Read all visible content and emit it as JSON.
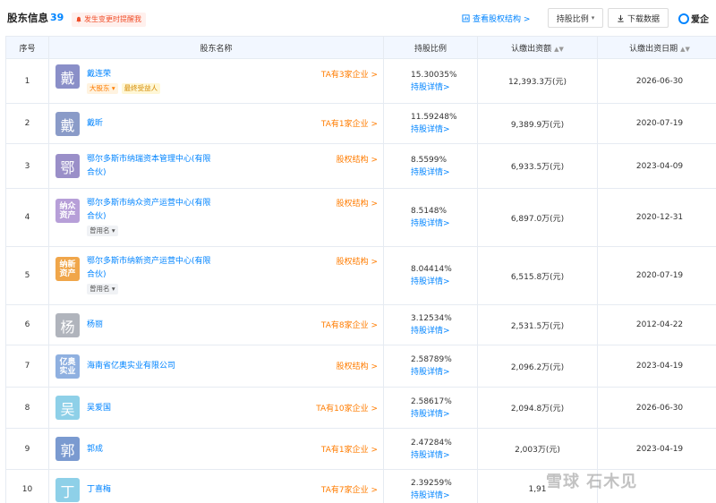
{
  "header": {
    "title": "股东信息",
    "count": "39",
    "remind_label": "发生变更时提醒我",
    "equity_chart_link": "查看股权结构 >",
    "sort_button": "持股比例",
    "download_button": "下载数据",
    "logo_text": "爱企"
  },
  "table": {
    "columns": [
      "序号",
      "股东名称",
      "持股比例",
      "认缴出资额",
      "认缴出资日期"
    ],
    "rows": [
      {
        "idx": "1",
        "avatar": "戴",
        "avatar_color": "#8a8fc8",
        "name_lines": [
          "戴连荣"
        ],
        "tags": [
          "大股东",
          "最终受益人"
        ],
        "right_link": "TA有3家企业 >",
        "ratio": "15.30035%",
        "ratio_link": "持股详情>",
        "capital": "12,393.3万(元)",
        "date": "2026-06-30"
      },
      {
        "idx": "2",
        "avatar": "戴",
        "avatar_color": "#8a9bc8",
        "name_lines": [
          "戴昕"
        ],
        "tags": [],
        "right_link": "TA有1家企业 >",
        "ratio": "11.59248%",
        "ratio_link": "持股详情>",
        "capital": "9,389.9万(元)",
        "date": "2020-07-19"
      },
      {
        "idx": "3",
        "avatar": "鄂",
        "avatar_color": "#9a8fc8",
        "name_lines": [
          "鄂尔多斯市纳瑞资本管理中心(有限",
          "合伙)"
        ],
        "tags": [],
        "right_link": "股权结构 >",
        "ratio": "8.5599%",
        "ratio_link": "持股详情>",
        "capital": "6,933.5万(元)",
        "date": "2023-04-09"
      },
      {
        "idx": "4",
        "avatar": "纳众\n资产",
        "avatar_color": "#b79fd8",
        "name_lines": [
          "鄂尔多斯市纳众资产运营中心(有限",
          "合伙)"
        ],
        "tags": [
          "曾用名"
        ],
        "right_link": "股权结构 >",
        "ratio": "8.5148%",
        "ratio_link": "持股详情>",
        "capital": "6,897.0万(元)",
        "date": "2020-12-31"
      },
      {
        "idx": "5",
        "avatar": "纳新\n资产",
        "avatar_color": "#f0a64a",
        "name_lines": [
          "鄂尔多斯市纳新资产运营中心(有限",
          "合伙)"
        ],
        "tags": [
          "曾用名"
        ],
        "right_link": "股权结构 >",
        "ratio": "8.04414%",
        "ratio_link": "持股详情>",
        "capital": "6,515.8万(元)",
        "date": "2020-07-19"
      },
      {
        "idx": "6",
        "avatar": "杨",
        "avatar_color": "#b0b4bc",
        "name_lines": [
          "杨丽"
        ],
        "tags": [],
        "right_link": "TA有8家企业 >",
        "ratio": "3.12534%",
        "ratio_link": "持股详情>",
        "capital": "2,531.5万(元)",
        "date": "2012-04-22"
      },
      {
        "idx": "7",
        "avatar": "亿奥\n实业",
        "avatar_color": "#8fb0e0",
        "name_lines": [
          "海南省亿奥实业有限公司"
        ],
        "tags": [],
        "right_link": "股权结构 >",
        "ratio": "2.58789%",
        "ratio_link": "持股详情>",
        "capital": "2,096.2万(元)",
        "date": "2023-04-19"
      },
      {
        "idx": "8",
        "avatar": "吴",
        "avatar_color": "#8ed0e8",
        "name_lines": [
          "吴爱国"
        ],
        "tags": [],
        "right_link": "TA有10家企业 >",
        "ratio": "2.58617%",
        "ratio_link": "持股详情>",
        "capital": "2,094.8万(元)",
        "date": "2026-06-30"
      },
      {
        "idx": "9",
        "avatar": "郭",
        "avatar_color": "#7a9ad0",
        "name_lines": [
          "郭成"
        ],
        "tags": [],
        "right_link": "TA有1家企业 >",
        "ratio": "2.47284%",
        "ratio_link": "持股详情>",
        "capital": "2,003万(元)",
        "date": "2023-04-19"
      },
      {
        "idx": "10",
        "avatar": "丁",
        "avatar_color": "#8ed0e8",
        "name_lines": [
          "丁喜梅"
        ],
        "tags": [],
        "right_link": "TA有7家企业 >",
        "ratio": "2.39259%",
        "ratio_link": "持股详情>",
        "capital": "1,91",
        "date": ""
      }
    ]
  },
  "watermark": "雪球 石木见"
}
